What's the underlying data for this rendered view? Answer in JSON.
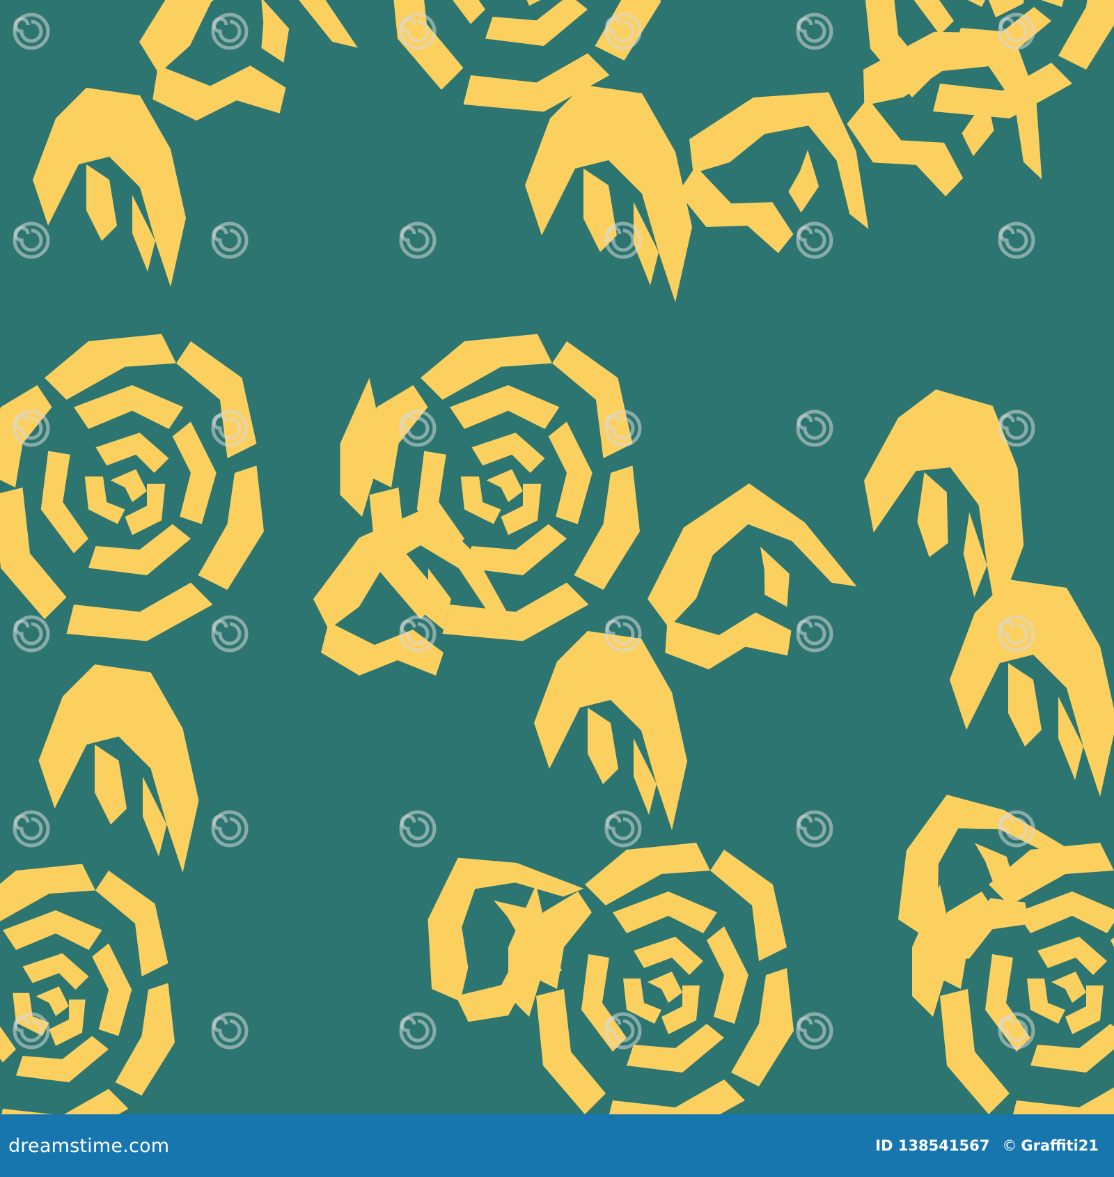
{
  "image": {
    "description_colors": {
      "background": "#2c7570",
      "flower": "#fcd05e",
      "footer": "#1676ad",
      "watermark": "#cfcfcf"
    },
    "watermark_text": "dreamstime",
    "icon": "spiral-watermark-icon"
  },
  "footer": {
    "site": "dreamstime.com",
    "id_label": "ID 138541567",
    "copyright_symbol": "©",
    "author": "Graffiti21"
  }
}
